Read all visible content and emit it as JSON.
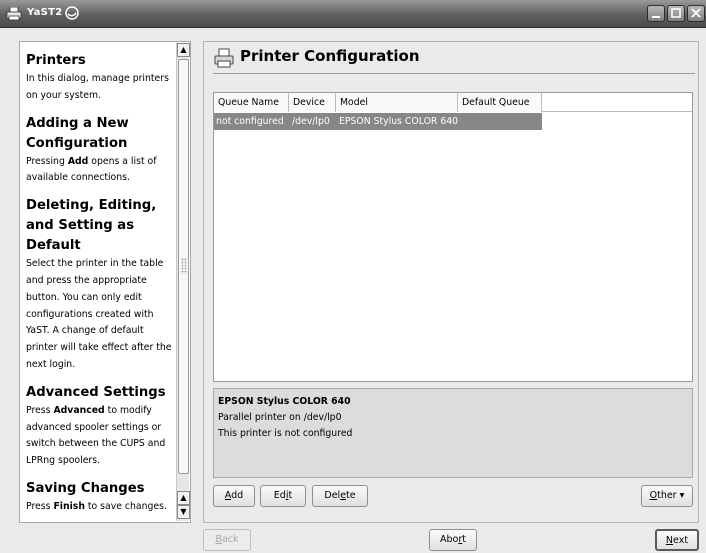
{
  "window": {
    "title": "YaST2"
  },
  "help": {
    "sections": [
      {
        "heading": "Printers",
        "body_parts": [
          {
            "t": "In this dialog, manage printers on your system.",
            "b": false
          }
        ]
      },
      {
        "heading": "Adding a New Configuration",
        "body_parts": [
          {
            "t": "Pressing ",
            "b": false
          },
          {
            "t": "Add",
            "b": true
          },
          {
            "t": " opens a list of available connections.",
            "b": false
          }
        ]
      },
      {
        "heading": "Deleting, Editing, and Setting as Default",
        "body_parts": [
          {
            "t": "Select the printer in the table and press the appropriate button. You can only edit configurations created with YaST. A change of default printer will take effect after the next login.",
            "b": false
          }
        ]
      },
      {
        "heading": "Advanced Settings",
        "body_parts": [
          {
            "t": "Press ",
            "b": false
          },
          {
            "t": "Advanced",
            "b": true
          },
          {
            "t": " to modify advanced spooler settings or switch between the CUPS and LPRng spoolers.",
            "b": false
          }
        ]
      },
      {
        "heading": "Saving Changes",
        "body_parts": [
          {
            "t": "Press ",
            "b": false
          },
          {
            "t": "Finish",
            "b": true
          },
          {
            "t": " to save changes.",
            "b": false
          }
        ]
      }
    ]
  },
  "main": {
    "title": "Printer Configuration",
    "table": {
      "columns": [
        "Queue Name",
        "Device",
        "Model",
        "Default Queue"
      ],
      "rows": [
        {
          "queue": "not configured",
          "device": "/dev/lp0",
          "model": "EPSON Stylus COLOR 640",
          "default": ""
        }
      ]
    },
    "detail": {
      "title": "EPSON Stylus COLOR 640",
      "line1": "Parallel printer on /dev/lp0",
      "line2": "This printer is not configured"
    },
    "buttons": {
      "add": {
        "pre": "",
        "u": "A",
        "post": "dd"
      },
      "edit": {
        "pre": "Ed",
        "u": "i",
        "post": "t"
      },
      "delete": {
        "pre": "Del",
        "u": "e",
        "post": "te"
      },
      "other": {
        "pre": "",
        "u": "O",
        "post": "ther ▾"
      }
    }
  },
  "footer": {
    "back": {
      "pre": "",
      "u": "B",
      "post": "ack"
    },
    "abort": {
      "pre": "Abo",
      "u": "r",
      "post": "t"
    },
    "next": {
      "pre": "",
      "u": "N",
      "post": "ext"
    }
  },
  "colors": {
    "selected_row": "#878787",
    "titlebar": "#5f5f5f"
  }
}
